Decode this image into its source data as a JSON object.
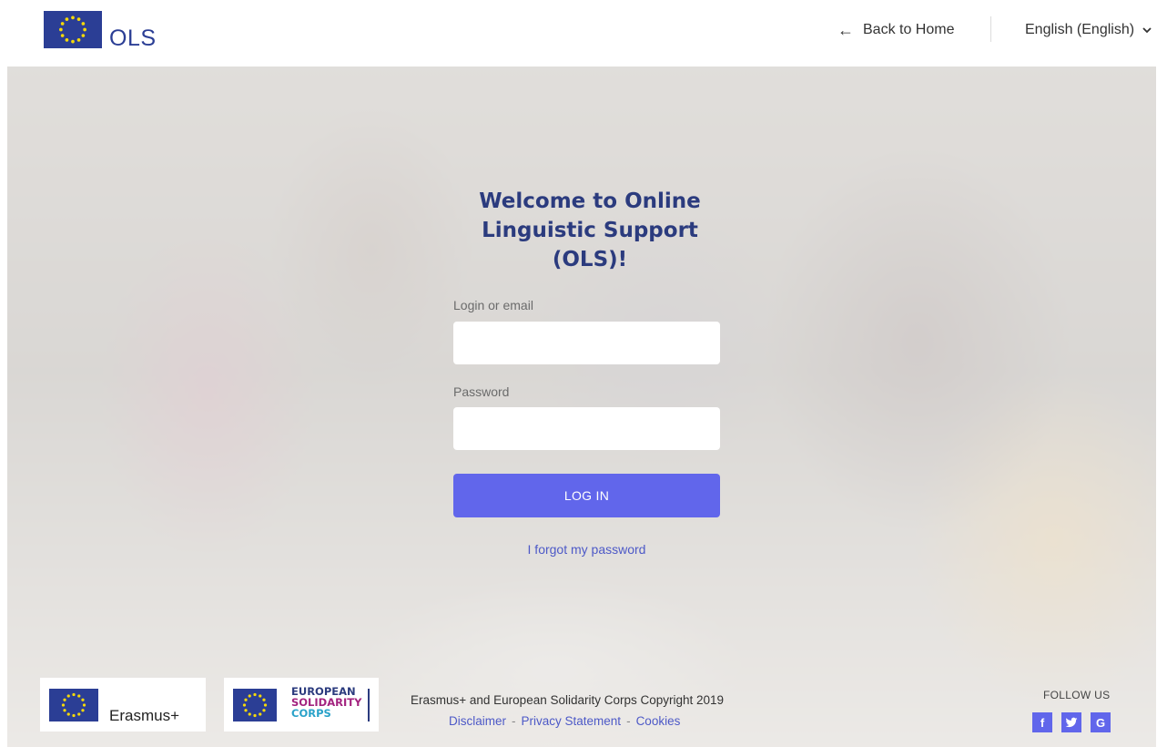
{
  "header": {
    "logo_text": "OLS",
    "back_home_label": "Back to Home",
    "language_label": "English (English)"
  },
  "login": {
    "title": "Welcome to Online Linguistic Support (OLS)!",
    "login_label": "Login or email",
    "login_value": "",
    "password_label": "Password",
    "password_value": "",
    "button_label": "LOG IN",
    "forgot_label": "I forgot my password"
  },
  "footer": {
    "erasmus_label": "Erasmus+",
    "esc_line1": "EUROPEAN",
    "esc_line2": "SOLIDARITY",
    "esc_line3": "CORPS",
    "copyright": "Erasmus+ and European Solidarity Corps Copyright 2019",
    "links": {
      "disclaimer": "Disclaimer",
      "privacy": "Privacy Statement",
      "cookies": "Cookies",
      "separator": "-"
    },
    "follow_label": "FOLLOW US",
    "social": {
      "facebook_glyph": "f",
      "google_glyph": "G"
    }
  },
  "colors": {
    "brand_blue": "#2b3e95",
    "title_blue": "#2b3b7e",
    "button_accent": "#6166eb",
    "link_blue": "#4d59c7",
    "esc_magenta": "#a3237f",
    "esc_cyan": "#2aa2c9"
  },
  "icons": [
    "eu-flag-icon",
    "arrow-left-icon",
    "chevron-down-icon",
    "facebook-icon",
    "twitter-icon",
    "google-icon"
  ]
}
